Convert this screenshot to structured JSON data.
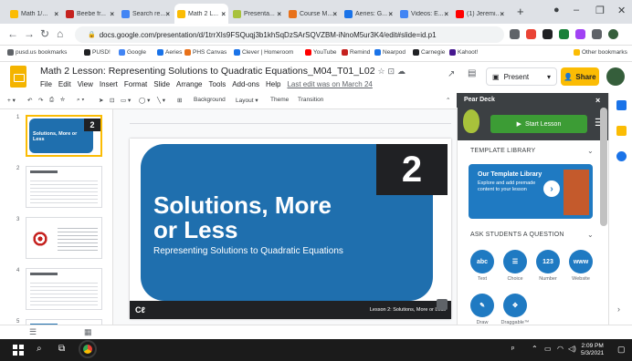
{
  "browser": {
    "tabs": [
      {
        "label": "Math 1/...",
        "color": "#fbbc04",
        "active": false
      },
      {
        "label": "Beebe fr...",
        "color": "#c5221f",
        "active": false
      },
      {
        "label": "Search re...",
        "color": "#4285f4",
        "active": false
      },
      {
        "label": "Math 2 L...",
        "color": "#fbbc04",
        "active": true
      },
      {
        "label": "Presenta...",
        "color": "#a8c23b",
        "active": false
      },
      {
        "label": "Course M...",
        "color": "#e8711a",
        "active": false
      },
      {
        "label": "Aeries: G...",
        "color": "#1a73e8",
        "active": false
      },
      {
        "label": "Videos: E...",
        "color": "#4285f4",
        "active": false
      },
      {
        "label": "(1) Jeremi...",
        "color": "#ff0000",
        "active": false
      }
    ],
    "new_tab": "+",
    "url": "docs.google.com/presentation/d/1trrXIs9FSQuqj3b1khSqDzSArSQVZBM-iNnoM5ur3K4/edit#slide=id.p1",
    "bookmarks": [
      {
        "label": "pusd.us bookmarks",
        "color": "#5f6368"
      },
      {
        "label": "PUSD!",
        "color": "#202124"
      },
      {
        "label": "Google",
        "color": "#4285f4"
      },
      {
        "label": "Aeries",
        "color": "#1a73e8"
      },
      {
        "label": "PHS Canvas",
        "color": "#e8711a"
      },
      {
        "label": "Clever | Homeroom",
        "color": "#1a73e8"
      },
      {
        "label": "YouTube",
        "color": "#ff0000"
      },
      {
        "label": "Remind",
        "color": "#c5221f"
      },
      {
        "label": "Nearpod",
        "color": "#1a73e8"
      },
      {
        "label": "Carnegie",
        "color": "#202124"
      },
      {
        "label": "Kahoot!",
        "color": "#46178f"
      }
    ],
    "other_bookmarks": "Other bookmarks"
  },
  "slides": {
    "title": "Math 2 Lesson: Representing Solutions to Quadratic Equations_M04_T01_L02",
    "menus": [
      "File",
      "Edit",
      "View",
      "Insert",
      "Format",
      "Slide",
      "Arrange",
      "Tools",
      "Add-ons",
      "Help"
    ],
    "last_edit": "Last edit was on March 24",
    "present_label": "Present",
    "share_label": "Share",
    "toolbar": {
      "background": "Background",
      "layout": "Layout",
      "theme": "Theme",
      "transition": "Transition"
    },
    "filmstrip": [
      {
        "num": "1",
        "title": "Solutions, More or Less"
      },
      {
        "num": "2",
        "title": ""
      },
      {
        "num": "3",
        "title": ""
      },
      {
        "num": "4",
        "title": ""
      },
      {
        "num": "5",
        "title": ""
      }
    ],
    "current_slide": {
      "number": "2",
      "title_line1": "Solutions, More",
      "title_line2": "or Less",
      "subtitle": "Representing Solutions to Quadratic Equations",
      "footer_logo": "Cℓ",
      "footer_text": "Lesson 2: Solutions, More or Less"
    }
  },
  "pear_deck": {
    "header": "Pear Deck",
    "close": "×",
    "start_lesson": "Start Lesson",
    "template_library": "TEMPLATE LIBRARY",
    "card_title": "Our Template Library",
    "card_desc": "Explore and add premade content to your lesson",
    "ask_students": "ASK STUDENTS A QUESTION",
    "question_types": [
      {
        "icon": "abc",
        "label": "Text"
      },
      {
        "icon": "☰",
        "label": "Choice"
      },
      {
        "icon": "123",
        "label": "Number"
      },
      {
        "icon": "www",
        "label": "Website"
      },
      {
        "icon": "✎",
        "label": "Draw"
      },
      {
        "icon": "✥",
        "label": "Draggable™"
      }
    ]
  },
  "taskbar": {
    "time": "2:09 PM",
    "date": "5/3/2021"
  }
}
